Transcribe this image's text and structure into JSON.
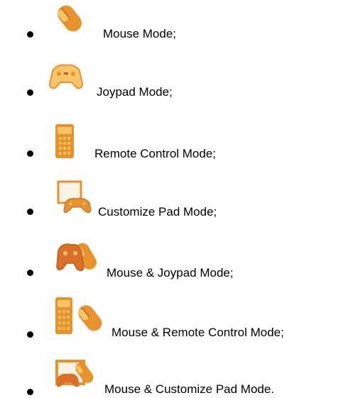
{
  "modes": [
    {
      "label": "Mouse Mode;",
      "icon": "mouse-icon"
    },
    {
      "label": "Joypad Mode;",
      "icon": "joypad-icon"
    },
    {
      "label": "Remote Control Mode;",
      "icon": "remote-control-icon"
    },
    {
      "label": "Customize Pad Mode;",
      "icon": "customize-pad-icon"
    },
    {
      "label": "Mouse & Joypad Mode;",
      "icon": "mouse-joypad-icon"
    },
    {
      "label": "Mouse & Remote Control Mode;",
      "icon": "mouse-remote-control-icon"
    },
    {
      "label": "Mouse & Customize Pad Mode.",
      "icon": "mouse-customize-pad-icon"
    }
  ],
  "colors": {
    "icon_orange": "#e8922e",
    "icon_light": "#f6c56a",
    "icon_dark": "#b8601c",
    "bullet": "#000000"
  }
}
